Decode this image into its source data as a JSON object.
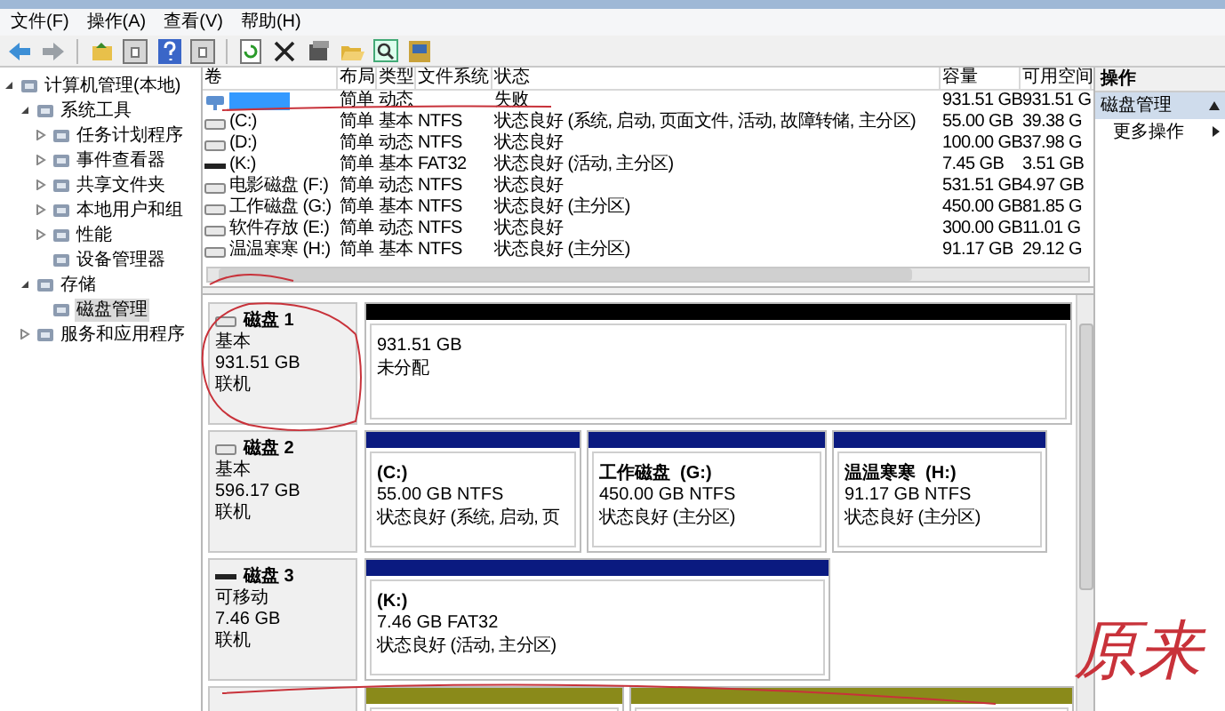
{
  "menu": [
    "文件(F)",
    "操作(A)",
    "查看(V)",
    "帮助(H)"
  ],
  "tree": [
    {
      "label": "计算机管理(本地)",
      "expanded": true,
      "selected": false,
      "children": [
        {
          "label": "系统工具",
          "expanded": true,
          "selected": false,
          "children": [
            {
              "label": "任务计划程序",
              "expanded": false,
              "selected": false
            },
            {
              "label": "事件查看器",
              "expanded": false,
              "selected": false
            },
            {
              "label": "共享文件夹",
              "expanded": false,
              "selected": false
            },
            {
              "label": "本地用户和组",
              "expanded": false,
              "selected": false
            },
            {
              "label": "性能",
              "expanded": false,
              "selected": false
            },
            {
              "label": "设备管理器",
              "selected": false
            }
          ]
        },
        {
          "label": "存储",
          "expanded": true,
          "selected": false,
          "children": [
            {
              "label": "磁盘管理",
              "selected": true
            }
          ]
        },
        {
          "label": "服务和应用程序",
          "expanded": false,
          "selected": false
        }
      ]
    }
  ],
  "volume_table": {
    "columns": [
      "卷",
      "布局",
      "类型",
      "文件系统",
      "状态",
      "容量",
      "可用空间"
    ],
    "rows": [
      {
        "kind": "failed",
        "selected": true,
        "cells": [
          "",
          "简单",
          "动态",
          "",
          "失败",
          "931.51 GB",
          "931.51 G"
        ]
      },
      {
        "kind": "disk",
        "selected": false,
        "cells": [
          "(C:)",
          "简单",
          "基本",
          "NTFS",
          "状态良好 (系统, 启动, 页面文件, 活动, 故障转储, 主分区)",
          "55.00 GB",
          "39.38 G"
        ]
      },
      {
        "kind": "disk",
        "selected": false,
        "cells": [
          "(D:)",
          "简单",
          "动态",
          "NTFS",
          "状态良好",
          "100.00 GB",
          "37.98 G"
        ]
      },
      {
        "kind": "removable",
        "selected": false,
        "cells": [
          "(K:)",
          "简单",
          "基本",
          "FAT32",
          "状态良好 (活动, 主分区)",
          "7.45 GB",
          "3.51 GB"
        ]
      },
      {
        "kind": "disk",
        "selected": false,
        "cells": [
          "电影磁盘 (F:)",
          "简单",
          "动态",
          "NTFS",
          "状态良好",
          "531.51 GB",
          "4.97 GB"
        ]
      },
      {
        "kind": "disk",
        "selected": false,
        "cells": [
          "工作磁盘 (G:)",
          "简单",
          "基本",
          "NTFS",
          "状态良好 (主分区)",
          "450.00 GB",
          "81.85 G"
        ]
      },
      {
        "kind": "disk",
        "selected": false,
        "cells": [
          "软件存放 (E:)",
          "简单",
          "动态",
          "NTFS",
          "状态良好",
          "300.00 GB",
          "11.01 G"
        ]
      },
      {
        "kind": "disk",
        "selected": false,
        "cells": [
          "温温寒寒 (H:)",
          "简单",
          "基本",
          "NTFS",
          "状态良好 (主分区)",
          "91.17 GB",
          "29.12 G"
        ]
      }
    ]
  },
  "disks": [
    {
      "kind": "fixed",
      "name": "磁盘 1",
      "type": "基本",
      "size": "931.51 GB",
      "status": "联机",
      "partitions": [
        {
          "kind": "unallocated",
          "size": "931.51 GB",
          "status": "未分配"
        }
      ]
    },
    {
      "kind": "fixed",
      "name": "磁盘 2",
      "type": "基本",
      "size": "596.17 GB",
      "status": "联机",
      "partitions": [
        {
          "kind": "primary",
          "name": "(C:)",
          "size": "55.00 GB NTFS",
          "status": "状态良好 (系统, 启动, 页"
        },
        {
          "kind": "primary",
          "name": "工作磁盘  (G:)",
          "size": "450.00 GB NTFS",
          "status": "状态良好 (主分区)"
        },
        {
          "kind": "primary",
          "name": "温温寒寒  (H:)",
          "size": "91.17 GB NTFS",
          "status": "状态良好 (主分区)"
        }
      ]
    },
    {
      "kind": "removable",
      "name": "磁盘 3",
      "type": "可移动",
      "size": "7.46 GB",
      "status": "联机",
      "partitions": [
        {
          "kind": "primary",
          "name": "(K:)",
          "size": "7.46 GB FAT32",
          "status": "状态良好 (活动, 主分区)"
        }
      ]
    },
    {
      "partitions": [
        {
          "kind": "dynamic"
        },
        {
          "kind": "dynamic"
        }
      ]
    }
  ],
  "actions": {
    "title": "操作",
    "section": {
      "label": "磁盘管理",
      "expanded": true
    },
    "items": [
      {
        "label": "更多操作"
      }
    ]
  },
  "annotation": {
    "text": "原来"
  }
}
